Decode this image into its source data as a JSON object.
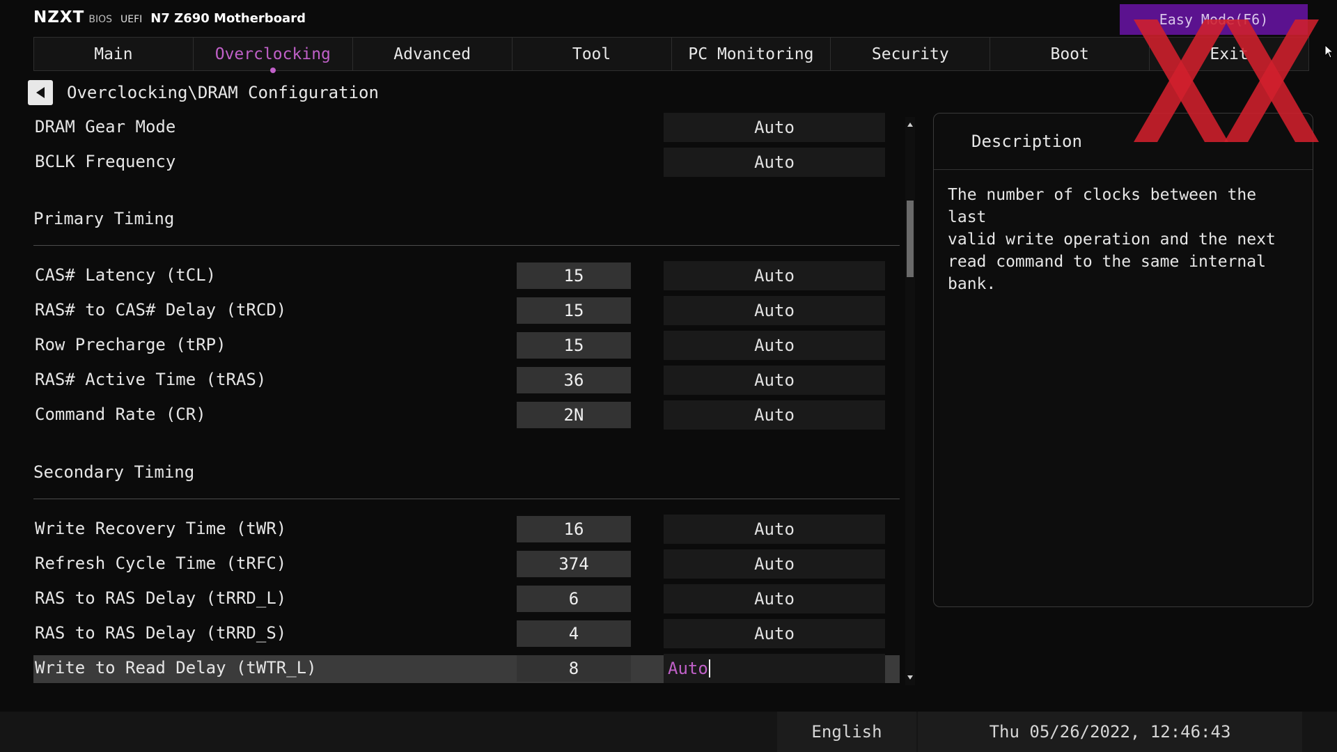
{
  "header": {
    "brand": "NZXT",
    "bios_label": "BIOS",
    "uefi_label": "UEFI",
    "board_name": "N7 Z690 Motherboard",
    "easy_mode_label": "Easy Mode(F6)",
    "easy_mode_color": "#5b128f"
  },
  "tabs": [
    {
      "label": "Main",
      "active": false
    },
    {
      "label": "Overclocking",
      "active": true
    },
    {
      "label": "Advanced",
      "active": false
    },
    {
      "label": "Tool",
      "active": false
    },
    {
      "label": "PC Monitoring",
      "active": false
    },
    {
      "label": "Security",
      "active": false
    },
    {
      "label": "Boot",
      "active": false
    },
    {
      "label": "Exit",
      "active": false
    }
  ],
  "accent_color": "#c060c8",
  "breadcrumb": {
    "back_icon": "arrow-left-icon",
    "path": "Overclocking\\DRAM Configuration"
  },
  "settings": {
    "dram_gear_mode": {
      "label": "DRAM Gear Mode",
      "value": "Auto"
    },
    "bclk_frequency": {
      "label": "BCLK Frequency",
      "value": "Auto"
    },
    "primary_timing": {
      "title": "Primary Timing",
      "items": [
        {
          "label": "CAS# Latency (tCL)",
          "current": "15",
          "value": "Auto"
        },
        {
          "label": "RAS# to CAS# Delay (tRCD)",
          "current": "15",
          "value": "Auto"
        },
        {
          "label": "Row Precharge (tRP)",
          "current": "15",
          "value": "Auto"
        },
        {
          "label": "RAS# Active Time (tRAS)",
          "current": "36",
          "value": "Auto"
        },
        {
          "label": "Command Rate (CR)",
          "current": "2N",
          "value": "Auto"
        }
      ]
    },
    "secondary_timing": {
      "title": "Secondary Timing",
      "items": [
        {
          "label": "Write Recovery Time (tWR)",
          "current": "16",
          "value": "Auto"
        },
        {
          "label": "Refresh Cycle Time (tRFC)",
          "current": "374",
          "value": "Auto"
        },
        {
          "label": "RAS to RAS Delay (tRRD_L)",
          "current": "6",
          "value": "Auto"
        },
        {
          "label": "RAS to RAS Delay (tRRD_S)",
          "current": "4",
          "value": "Auto"
        },
        {
          "label": "Write to Read Delay (tWTR_L)",
          "current": "8",
          "value": "Auto"
        }
      ]
    }
  },
  "scroll": {
    "position": 0.15
  },
  "description": {
    "title": "Description",
    "text": "The number of clocks between the last\nvalid write operation and the next\nread command to the same internal\nbank."
  },
  "watermark": {
    "text": "XX",
    "color": "#d0202c"
  },
  "status_bar": {
    "language": "English",
    "datetime": "Thu 05/26/2022, 12:46:43"
  }
}
